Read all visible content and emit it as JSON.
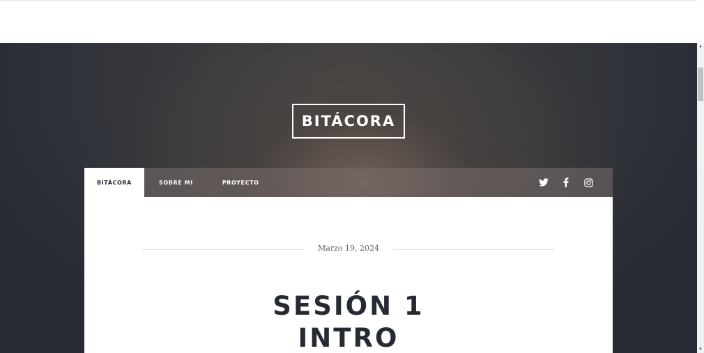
{
  "site": {
    "title": "BITÁCORA"
  },
  "nav": {
    "items": [
      {
        "label": "BITÁCORA",
        "active": true
      },
      {
        "label": "SOBRE MI",
        "active": false
      },
      {
        "label": "PROYECTO",
        "active": false
      }
    ],
    "social": [
      "twitter-icon",
      "facebook-icon",
      "instagram-icon"
    ]
  },
  "post": {
    "date": "Marzo 19, 2024",
    "title_line1": "SESIÓN 1",
    "title_line2": "INTRO"
  },
  "colors": {
    "dark": "#252a33",
    "white": "#ffffff"
  }
}
